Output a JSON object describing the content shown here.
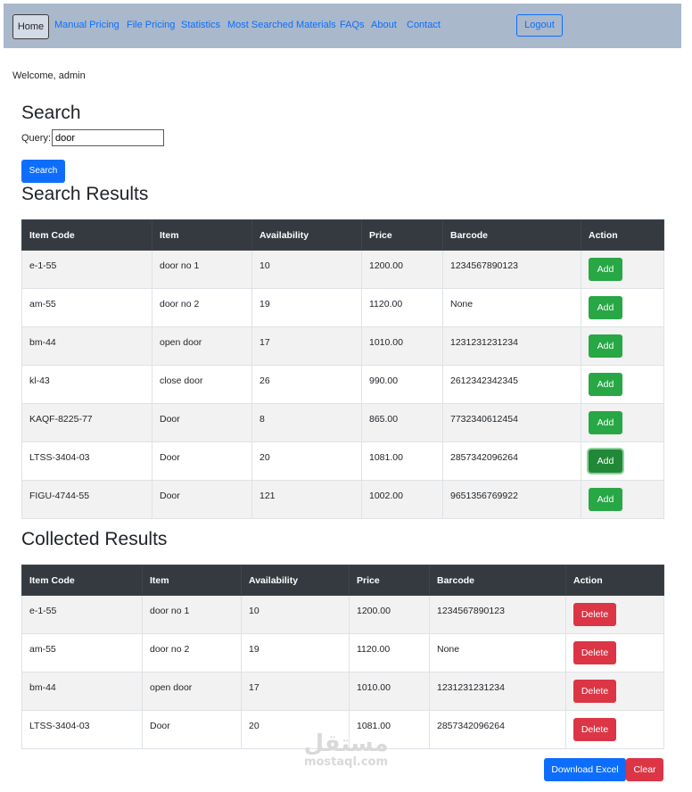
{
  "nav": {
    "home": "Home",
    "links": [
      "Manual Pricing",
      "File Pricing",
      "Statistics",
      "Most Searched Materials",
      "FAQs",
      "About",
      "Contact"
    ],
    "logout": "Logout"
  },
  "welcome": "Welcome, admin",
  "search": {
    "heading": "Search",
    "query_label": "Query:",
    "query_value": "door",
    "button": "Search"
  },
  "results": {
    "heading": "Search Results",
    "columns": [
      "Item Code",
      "Item",
      "Availability",
      "Price",
      "Barcode",
      "Action"
    ],
    "rows": [
      {
        "code": "e-1-55",
        "item": "door no 1",
        "availability": "10",
        "price": "1200.00",
        "barcode": "1234567890123",
        "action": "Add"
      },
      {
        "code": "am-55",
        "item": "door no 2",
        "availability": "19",
        "price": "1120.00",
        "barcode": "None",
        "action": "Add"
      },
      {
        "code": "bm-44",
        "item": "open door",
        "availability": "17",
        "price": "1010.00",
        "barcode": "1231231231234",
        "action": "Add"
      },
      {
        "code": "kl-43",
        "item": "close door",
        "availability": "26",
        "price": "990.00",
        "barcode": "2612342342345",
        "action": "Add"
      },
      {
        "code": "KAQF-8225-77",
        "item": "Door",
        "availability": "8",
        "price": "865.00",
        "barcode": "7732340612454",
        "action": "Add"
      },
      {
        "code": "LTSS-3404-03",
        "item": "Door",
        "availability": "20",
        "price": "1081.00",
        "barcode": "2857342096264",
        "action": "Add"
      },
      {
        "code": "FIGU-4744-55",
        "item": "Door",
        "availability": "121",
        "price": "1002.00",
        "barcode": "9651356769922",
        "action": "Add"
      }
    ]
  },
  "collected": {
    "heading": "Collected Results",
    "columns": [
      "Item Code",
      "Item",
      "Availability",
      "Price",
      "Barcode",
      "Action"
    ],
    "rows": [
      {
        "code": "e-1-55",
        "item": "door no 1",
        "availability": "10",
        "price": "1200.00",
        "barcode": "1234567890123",
        "action": "Delete"
      },
      {
        "code": "am-55",
        "item": "door no 2",
        "availability": "19",
        "price": "1120.00",
        "barcode": "None",
        "action": "Delete"
      },
      {
        "code": "bm-44",
        "item": "open door",
        "availability": "17",
        "price": "1010.00",
        "barcode": "1231231231234",
        "action": "Delete"
      },
      {
        "code": "LTSS-3404-03",
        "item": "Door",
        "availability": "20",
        "price": "1081.00",
        "barcode": "2857342096264",
        "action": "Delete"
      }
    ],
    "download": "Download Excel",
    "clear": "Clear"
  },
  "watermark": {
    "arabic": "مستقل",
    "latin": "mostaql.com"
  },
  "colors": {
    "navbar": "#a9b8cb",
    "primary": "#0d6efd",
    "success": "#28a745",
    "danger": "#dc3545",
    "table_header": "#343a40"
  }
}
